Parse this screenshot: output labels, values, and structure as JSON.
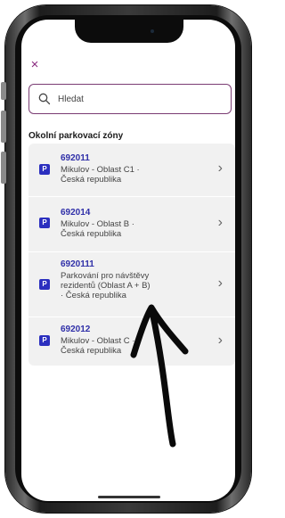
{
  "icons": {
    "close": "close-icon",
    "search": "search-icon",
    "badge": "parking-badge-icon",
    "chevron": "chevron-right-icon"
  },
  "colors": {
    "accent": "#7a3c73",
    "badge": "#2b2fbf",
    "zone_id": "#2f2fa8"
  },
  "header": {
    "close_label": "×"
  },
  "search": {
    "placeholder": "Hledat",
    "value": ""
  },
  "section": {
    "title": "Okolní parkovací zóny"
  },
  "zones": [
    {
      "badge": "P",
      "id": "692011",
      "desc_lines": [
        "Mikulov - Oblast C1 ·",
        "Česká republika"
      ]
    },
    {
      "badge": "P",
      "id": "692014",
      "desc_lines": [
        "Mikulov - Oblast B ·",
        "Česká republika"
      ]
    },
    {
      "badge": "P",
      "id": "6920111",
      "desc_lines": [
        "Parkování pro návštěvy",
        "rezidentů (Oblast A + B)",
        "· Česká republika"
      ]
    },
    {
      "badge": "P",
      "id": "692012",
      "desc_lines": [
        "Mikulov - Oblast C ·",
        "Česká republika"
      ]
    }
  ],
  "chevron_glyph": "›"
}
